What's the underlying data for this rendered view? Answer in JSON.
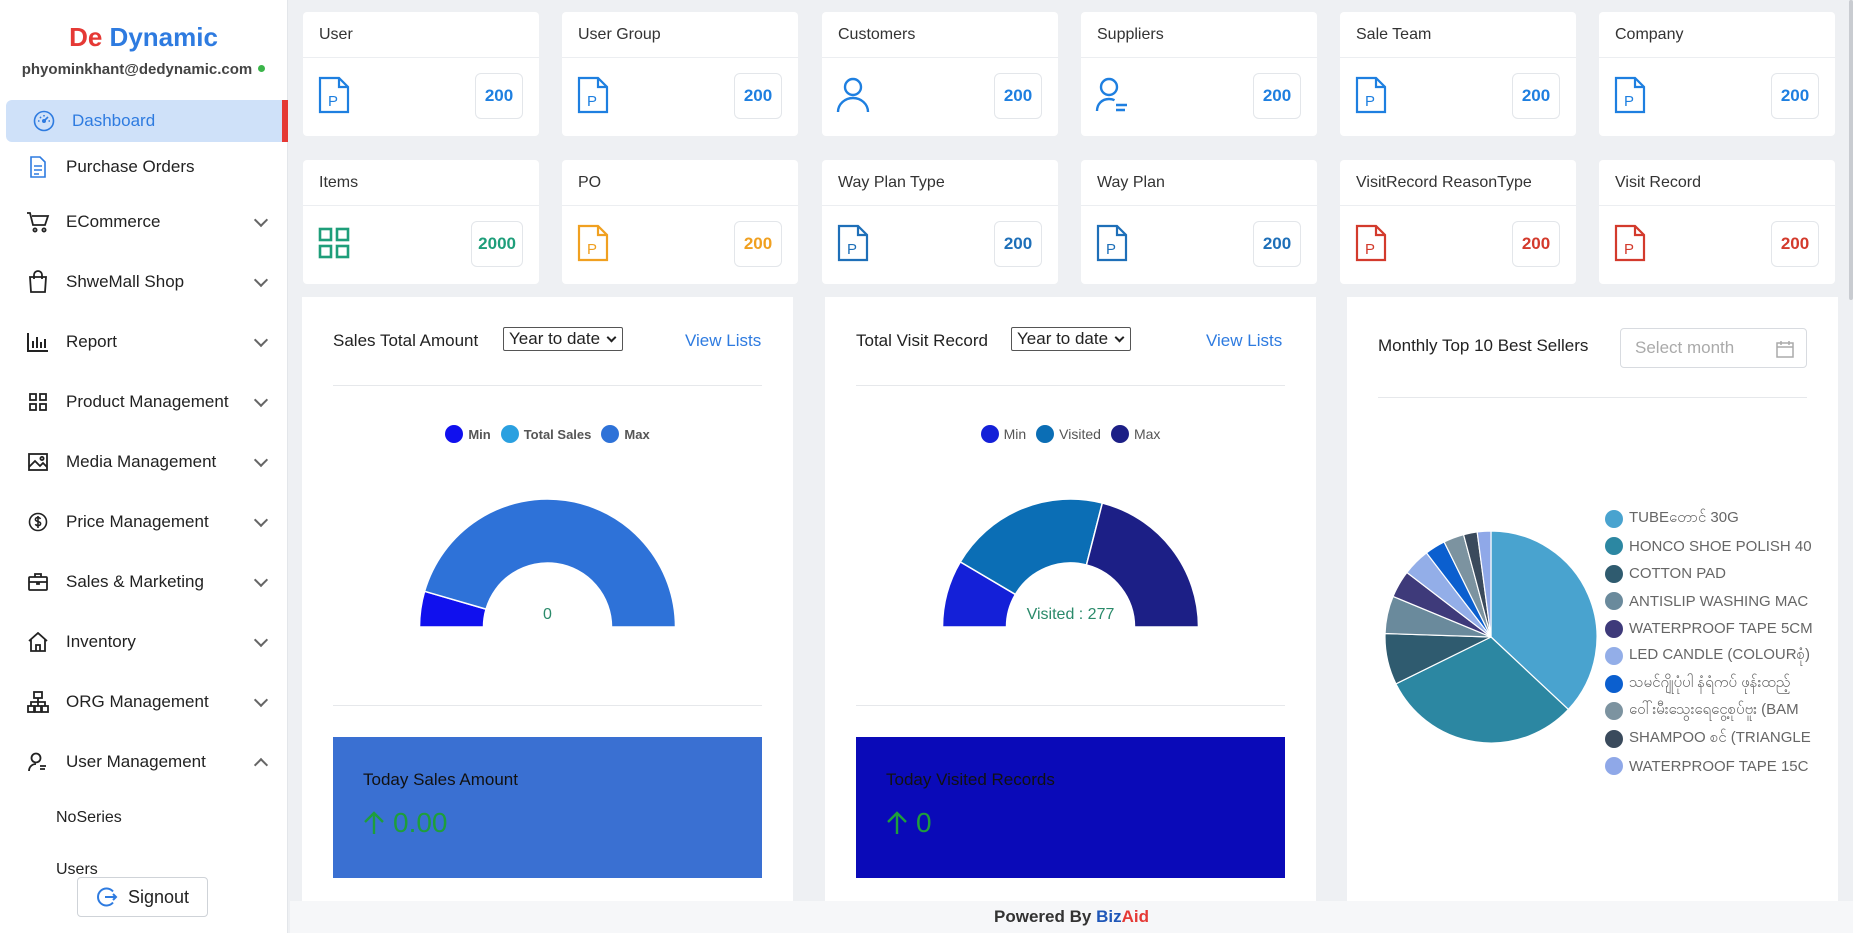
{
  "brand": {
    "part1": "De",
    "part2": "Dynamic"
  },
  "user": {
    "email": "phyominkhant@dedynamic.com"
  },
  "sidebar": {
    "items": [
      {
        "label": "Dashboard",
        "icon": "gauge-icon",
        "active": true
      },
      {
        "label": "Purchase Orders",
        "icon": "document-icon"
      },
      {
        "label": "ECommerce",
        "icon": "cart-icon",
        "expandable": true
      },
      {
        "label": "ShweMall Shop",
        "icon": "bag-icon",
        "expandable": true
      },
      {
        "label": "Report",
        "icon": "bar-chart-icon",
        "expandable": true
      },
      {
        "label": "Product Management",
        "icon": "grid-icon",
        "expandable": true
      },
      {
        "label": "Media Management",
        "icon": "image-icon",
        "expandable": true
      },
      {
        "label": "Price Management",
        "icon": "dollar-icon",
        "expandable": true
      },
      {
        "label": "Sales & Marketing",
        "icon": "briefcase-icon",
        "expandable": true
      },
      {
        "label": "Inventory",
        "icon": "home-icon",
        "expandable": true
      },
      {
        "label": "ORG Management",
        "icon": "org-icon",
        "expandable": true
      },
      {
        "label": "User Management",
        "icon": "user-manage-icon",
        "expanded": true
      }
    ],
    "sub_items": [
      "NoSeries",
      "Users"
    ],
    "signout": "Signout"
  },
  "cards": [
    {
      "title": "User",
      "value": "200",
      "color": "#1e7fe0"
    },
    {
      "title": "User Group",
      "value": "200",
      "color": "#1e7fe0"
    },
    {
      "title": "Customers",
      "value": "200",
      "color": "#1e7fe0"
    },
    {
      "title": "Suppliers",
      "value": "200",
      "color": "#1e7fe0"
    },
    {
      "title": "Sale Team",
      "value": "200",
      "color": "#1e7fe0"
    },
    {
      "title": "Company",
      "value": "200",
      "color": "#1e7fe0"
    },
    {
      "title": "Items",
      "value": "2000",
      "color": "#1e9e7a"
    },
    {
      "title": "PO",
      "value": "200",
      "color": "#f0a020"
    },
    {
      "title": "Way Plan Type",
      "value": "200",
      "color": "#1e6fb8"
    },
    {
      "title": "Way Plan",
      "value": "200",
      "color": "#1e6fb8"
    },
    {
      "title": "VisitRecord ReasonType",
      "value": "200",
      "color": "#d33a2c"
    },
    {
      "title": "Visit Record",
      "value": "200",
      "color": "#d33a2c"
    }
  ],
  "sales_panel": {
    "title": "Sales Total Amount",
    "filter": "Year to date",
    "link": "View Lists",
    "legend": [
      "Min",
      "Total Sales",
      "Max"
    ],
    "center_label": "0",
    "summary_title": "Today Sales Amount",
    "summary_value": "0.00"
  },
  "visit_panel": {
    "title": "Total Visit Record",
    "filter": "Year to date",
    "link": "View Lists",
    "legend": [
      "Min",
      "Visited",
      "Max"
    ],
    "center_label": "Visited : 277",
    "summary_title": "Today Visited Records",
    "summary_value": "0"
  },
  "sellers_panel": {
    "title": "Monthly Top 10 Best Sellers",
    "month_placeholder": "Select month"
  },
  "footer": {
    "prefix": "Powered By",
    "brand1": "Biz",
    "brand2": "Aid"
  },
  "chart_data": [
    {
      "type": "pie",
      "title": "",
      "semi": true,
      "categories": [
        "Min",
        "Total Sales",
        "Max"
      ],
      "values": [
        9,
        0,
        91
      ],
      "colors": [
        "#1010ee",
        "#2aa0e0",
        "#2e72d8"
      ]
    },
    {
      "type": "pie",
      "title": "",
      "semi": true,
      "categories": [
        "Min",
        "Visited",
        "Max"
      ],
      "values": [
        17,
        41,
        42
      ],
      "colors": [
        "#1420d8",
        "#0b6eb5",
        "#1c1f86"
      ]
    },
    {
      "type": "pie",
      "title": "",
      "categories": [
        "TUBEတောင် 30G",
        "HONCO SHOE POLISH 40",
        "COTTON PAD",
        "ANTISLIP WASHING MAC",
        "WATERPROOF TAPE 5CM",
        "LED CANDLE (COLOURစုံ)",
        "သမင်ဂျိုပုံပါ နံရံကပ် ဖုန်းထည့်",
        "ဝေါ်းမီးသွေးရေငွေ့စုပ်ဗူး (BAM",
        "SHAMPOO စင် (TRIANGLE",
        "WATERPROOF TAPE 15C"
      ],
      "values": [
        35.5,
        29.5,
        7.5,
        5.5,
        4,
        4,
        3,
        3,
        2,
        2
      ],
      "colors": [
        "#49a3cf",
        "#2c87a2",
        "#2f5b6f",
        "#6a8a9c",
        "#3e3a7a",
        "#93aee8",
        "#0b5fcf",
        "#7c93a0",
        "#3a4a5c",
        "#8fa8e8"
      ]
    }
  ]
}
